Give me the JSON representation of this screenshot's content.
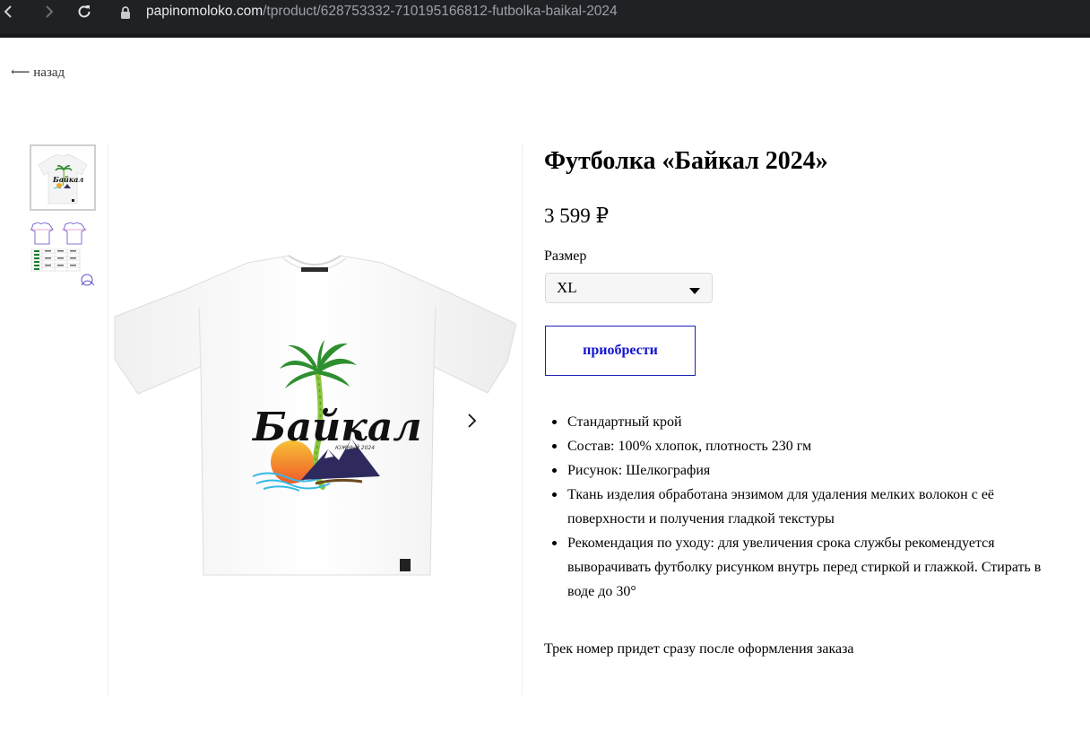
{
  "browser": {
    "url_host": "papinomoloko.com",
    "url_path": "/tproduct/628753332-710195166812-futbolka-baikal-2024",
    "icons": [
      "back-icon",
      "forward-icon",
      "reload-icon",
      "lock-icon"
    ]
  },
  "page": {
    "back_label": "⟵ назад"
  },
  "gallery": {
    "print_title": "Байкал",
    "print_subtitle": "ЮЖНЫЙ 2024",
    "next_icon": "chevron-right-icon"
  },
  "product": {
    "title": "Футболка «Байкал 2024»",
    "price": "3 599 ₽",
    "size_label": "Размер",
    "size_value": "XL",
    "buy_label": "приобрести",
    "features": [
      "Стандартный крой",
      "Состав: 100% хлопок, плотность 230 гм",
      "Рисунок: Шелкография",
      "Ткань изделия обработана энзимом для удаления мелких волокон с её поверхности и получения гладкой текстуры",
      "Рекомендация по уходу: для увеличения срока службы рекомендуется выворачивать футболку рисунком внутрь перед стиркой и глажкой. Стирать в воде до 30°"
    ],
    "track_note": "Трек номер придет сразу после оформления заказа"
  },
  "colors": {
    "accent": "#1313cf",
    "chrome_bg": "#202124"
  }
}
